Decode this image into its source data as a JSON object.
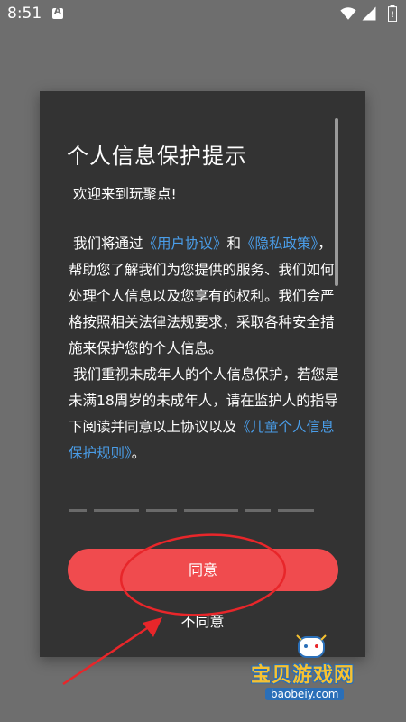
{
  "status_bar": {
    "time": "8:51",
    "app_icon": "notification-a-icon",
    "wifi_icon": "wifi-icon",
    "signal_icon": "cell-signal-icon",
    "battery_icon": "battery-icon"
  },
  "dialog": {
    "title": "个人信息保护提示",
    "welcome": "欢迎来到玩聚点!",
    "para1_prefix": "我们将通过",
    "user_agreement_link": "《用户协议》",
    "para1_and": "和",
    "privacy_policy_link": "《隐私政策》",
    "para1_suffix": "，帮助您了解我们为您提供的服务、我们如何处理个人信息以及您享有的权利。我们会严格按照相关法律法规要求，采取各种安全措施来保护您的个人信息。",
    "para2_prefix": "我们重视未成年人的个人信息保护，若您是未满18周岁的未成年人，请在监护人的指导下阅读并同意以上协议以及",
    "children_rules_link": "《儿童个人信息保护规则》",
    "para2_suffix": "。",
    "agree_label": "同意",
    "disagree_label": "不同意"
  },
  "watermark": {
    "brand": "宝贝游戏网",
    "url": "baobeiy.com"
  },
  "colors": {
    "background": "#6e6e6e",
    "dialog_bg": "#333333",
    "accent_button": "#f04b4e",
    "link": "#4a9eea",
    "annotation_red": "#e8262a"
  }
}
